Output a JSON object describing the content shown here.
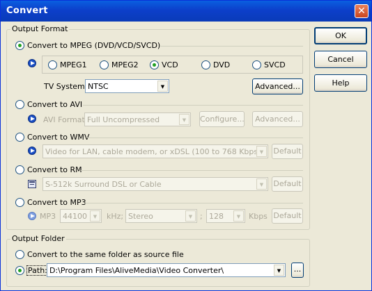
{
  "window": {
    "title": "Convert",
    "close_label": "✕"
  },
  "buttons": {
    "ok": "OK",
    "cancel": "Cancel",
    "help": "Help"
  },
  "output_format": {
    "group_label": "Output Format",
    "mpeg": {
      "radio_label": "Convert to MPEG (DVD/VCD/SVCD)",
      "selected": true,
      "options": [
        "MPEG1",
        "MPEG2",
        "VCD",
        "DVD",
        "SVCD"
      ],
      "selected_option": "VCD",
      "tv_system_label": "TV System:",
      "tv_system_value": "NTSC",
      "advanced_label": "Advanced..."
    },
    "avi": {
      "radio_label": "Convert to AVI",
      "format_label": "AVI Format:",
      "format_value": "Full Uncompressed",
      "configure_label": "Configure...",
      "advanced_label": "Advanced..."
    },
    "wmv": {
      "radio_label": "Convert to WMV",
      "profile_value": "Video for LAN, cable modem, or xDSL (100 to 768 Kbps)",
      "default_label": "Default"
    },
    "rm": {
      "radio_label": "Convert to RM",
      "profile_value": "S-512k Surround DSL or Cable",
      "default_label": "Default"
    },
    "mp3": {
      "radio_label": "Convert to MP3",
      "mp3_label": "MP3",
      "rate_value": "44100",
      "khz_label": "kHz;",
      "channel_value": "Stereo",
      "separator": ";",
      "bitrate_value": "128",
      "kbps_label": "Kbps",
      "default_label": "Default"
    }
  },
  "output_folder": {
    "group_label": "Output Folder",
    "same_folder_label": "Convert to the same folder as source file",
    "path_label": "Path:",
    "path_value": "D:\\Program Files\\AliveMedia\\Video Converter\\",
    "browse_label": "...",
    "selected": "path"
  },
  "colors": {
    "titlebar": "#0a3bb8",
    "dialog_bg": "#ece9d8",
    "radio_dot": "#21a121",
    "disabled_text": "#aca899"
  }
}
